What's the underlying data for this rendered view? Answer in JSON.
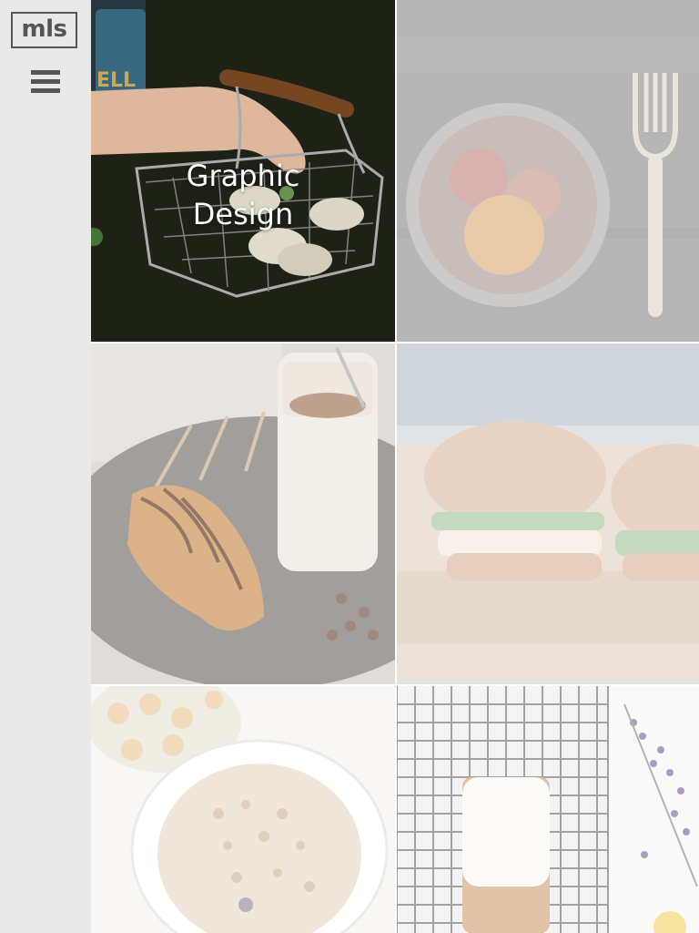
{
  "brand": {
    "logo_text": "mls"
  },
  "nav": {
    "menu_icon": "hamburger-menu-icon"
  },
  "tiles": [
    {
      "caption_line1": "Graphic",
      "caption_line2": "Design"
    }
  ],
  "colors": {
    "sidebar_bg": "#e9e9e9",
    "logo": "#555555",
    "caption": "#ffffff"
  }
}
